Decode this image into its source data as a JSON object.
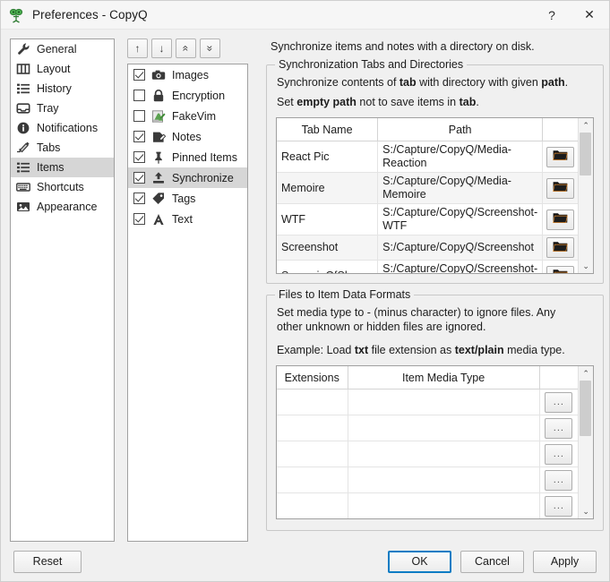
{
  "window": {
    "title": "Preferences - CopyQ",
    "app_icon": "copyq-logo-icon",
    "help_button": "?",
    "close_button": "✕"
  },
  "sidebar": {
    "items": [
      {
        "label": "General",
        "icon": "wrench-icon",
        "selected": false
      },
      {
        "label": "Layout",
        "icon": "layout-icon",
        "selected": false
      },
      {
        "label": "History",
        "icon": "list-icon",
        "selected": false
      },
      {
        "label": "Tray",
        "icon": "tray-icon",
        "selected": false
      },
      {
        "label": "Notifications",
        "icon": "info-circle-icon",
        "selected": false
      },
      {
        "label": "Tabs",
        "icon": "tabs-icon",
        "selected": false
      },
      {
        "label": "Items",
        "icon": "items-list-icon",
        "selected": true
      },
      {
        "label": "Shortcuts",
        "icon": "keyboard-icon",
        "selected": false
      },
      {
        "label": "Appearance",
        "icon": "image-icon",
        "selected": false
      }
    ]
  },
  "plugins": {
    "toolbar": [
      {
        "name": "move-up-button",
        "glyph": "↑"
      },
      {
        "name": "move-down-button",
        "glyph": "↓"
      },
      {
        "name": "move-to-top-button",
        "glyph": "«"
      },
      {
        "name": "move-to-bottom-button",
        "glyph": "»"
      }
    ],
    "items": [
      {
        "label": "Images",
        "icon": "camera-icon",
        "checked": true,
        "selected": false
      },
      {
        "label": "Encryption",
        "icon": "lock-icon",
        "checked": false,
        "selected": false
      },
      {
        "label": "FakeVim",
        "icon": "fakevim-icon",
        "checked": false,
        "selected": false
      },
      {
        "label": "Notes",
        "icon": "note-edit-icon",
        "checked": true,
        "selected": false
      },
      {
        "label": "Pinned Items",
        "icon": "pin-icon",
        "checked": true,
        "selected": false
      },
      {
        "label": "Synchronize",
        "icon": "synchronize-icon",
        "checked": true,
        "selected": true
      },
      {
        "label": "Tags",
        "icon": "tag-icon",
        "checked": true,
        "selected": false
      },
      {
        "label": "Text",
        "icon": "text-a-icon",
        "checked": true,
        "selected": false
      }
    ]
  },
  "main": {
    "intro": "Synchronize items and notes with a directory on disk.",
    "sync_group": {
      "legend": "Synchronization Tabs and Directories",
      "desc_1_pre": "Synchronize contents of ",
      "desc_1_b1": "tab",
      "desc_1_mid": " with directory with given ",
      "desc_1_b2": "path",
      "desc_1_post": ".",
      "desc_2_pre": "Set ",
      "desc_2_b1": "empty path",
      "desc_2_mid": " not to save items in ",
      "desc_2_b2": "tab",
      "desc_2_post": ".",
      "columns": [
        "Tab Name",
        "Path",
        ""
      ],
      "rows": [
        {
          "tab": "React Pic",
          "path": "S:/Capture/CopyQ/Media-Reaction",
          "button": "browse-folder"
        },
        {
          "tab": "Memoire",
          "path": "S:/Capture/CopyQ/Media-Memoire",
          "button": "browse-folder"
        },
        {
          "tab": "WTF",
          "path": "S:/Capture/CopyQ/Screenshot-WTF",
          "button": "browse-folder"
        },
        {
          "tab": "Screenshot",
          "path": "S:/Capture/CopyQ/Screenshot",
          "button": "browse-folder"
        },
        {
          "tab": "ScreenieOfShame",
          "path": "S:/Capture/CopyQ/Screenshot-Shame",
          "button": "browse-folder"
        }
      ]
    },
    "formats_group": {
      "legend": "Files to Item Data Formats",
      "desc_1": "Set media type to - (minus character) to ignore files. Any other unknown or hidden files are ignored.",
      "desc_2_pre": "Example: Load ",
      "desc_2_b1": "txt",
      "desc_2_mid": " file extension as ",
      "desc_2_b2": "text/plain",
      "desc_2_post": " media type.",
      "columns": [
        "Extensions",
        "Item Media Type",
        ""
      ],
      "rows": [
        {
          "extension": "",
          "media_type": "",
          "button": "..."
        },
        {
          "extension": "",
          "media_type": "",
          "button": "..."
        },
        {
          "extension": "",
          "media_type": "",
          "button": "..."
        },
        {
          "extension": "",
          "media_type": "",
          "button": "..."
        },
        {
          "extension": "",
          "media_type": "",
          "button": "..."
        }
      ]
    },
    "scrollbar": {
      "up": "⌃",
      "down": "⌄"
    }
  },
  "footer": {
    "reset": "Reset",
    "ok": "OK",
    "cancel": "Cancel",
    "apply": "Apply"
  },
  "colors": {
    "window_bg": "#f0f0f0",
    "focus_blue": "#0a7cc4",
    "selection_gray": "#d6d6d6",
    "folder_icon": "#1a1a1a",
    "folder_accent": "#e08a2e"
  }
}
